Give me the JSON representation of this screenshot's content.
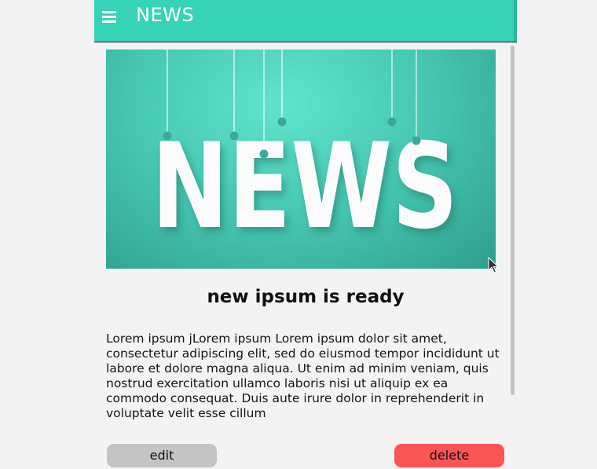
{
  "app": {
    "title": "NEWS"
  },
  "article": {
    "image_word": "NEWS",
    "headline": "new ipsum is ready",
    "body": "Lorem ipsum jLorem ipsum Lorem ipsum dolor sit amet, consectetur adipiscing elit, sed do eiusmod tempor incididunt ut labore et dolore magna aliqua. Ut enim ad minim veniam, quis nostrud exercitation ullamco laboris nisi ut aliquip ex ea commodo consequat. Duis aute irure dolor in reprehenderit in voluptate velit esse cillum"
  },
  "actions": {
    "edit_label": "edit",
    "delete_label": "delete"
  },
  "icons": {
    "menu": "hamburger-menu-icon",
    "cursor": "mouse-pointer-icon"
  },
  "colors": {
    "accent": "#37d3b6",
    "delete": "#f95555",
    "edit": "#c4c4c4"
  }
}
